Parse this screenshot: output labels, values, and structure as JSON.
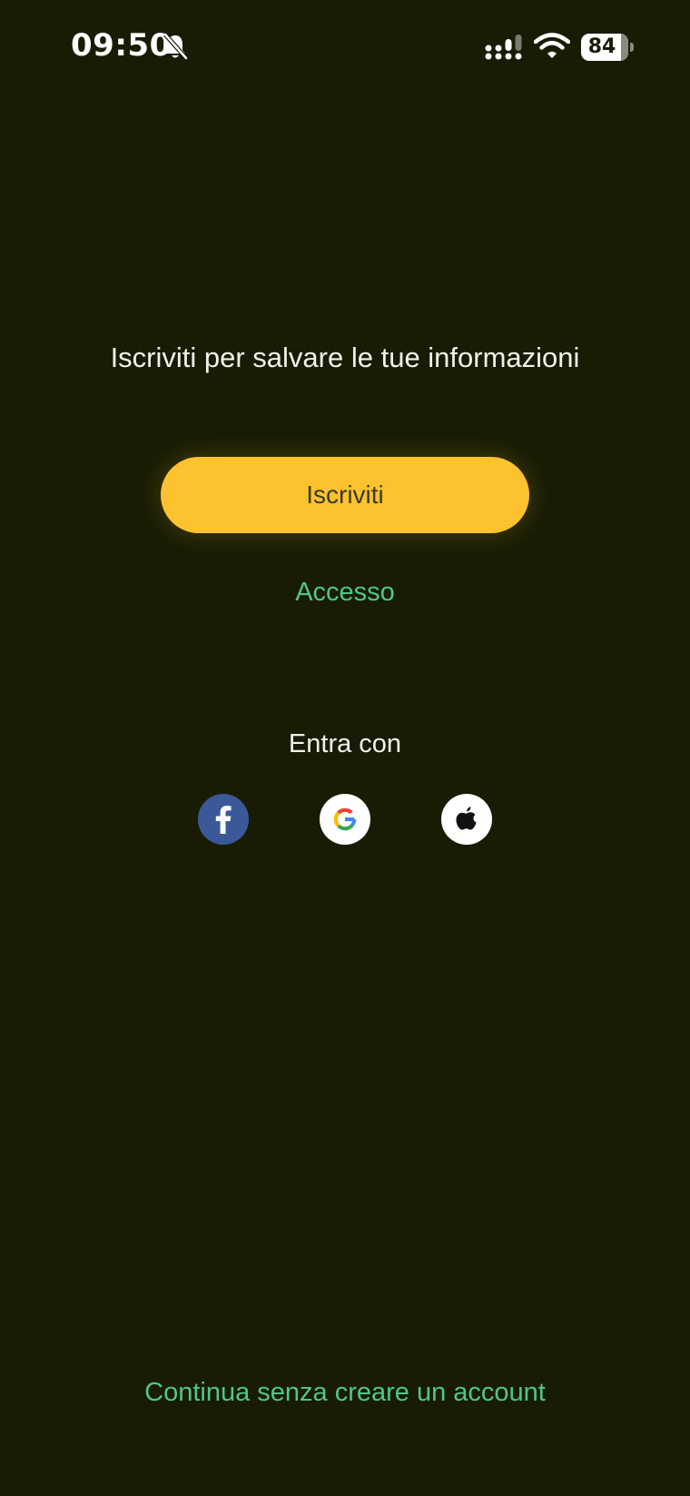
{
  "status_bar": {
    "time": "09:50",
    "battery_level": 84,
    "battery_text": "84",
    "icons": [
      "bell-muted-icon",
      "signal-icon",
      "wifi-icon",
      "battery-icon"
    ]
  },
  "main": {
    "headline": "Iscriviti per salvare le tue informazioni",
    "signup_label": "Iscriviti",
    "login_label": "Accesso",
    "social_label": "Entra con",
    "social_buttons": [
      {
        "name": "facebook",
        "icon": "facebook-icon"
      },
      {
        "name": "google",
        "icon": "google-icon"
      },
      {
        "name": "apple",
        "icon": "apple-icon"
      }
    ],
    "guest_label": "Continua senza creare un account"
  },
  "colors": {
    "background": "#181c05",
    "accent_button": "#fdc22f",
    "link": "#52c48a",
    "facebook": "#3b5998"
  }
}
